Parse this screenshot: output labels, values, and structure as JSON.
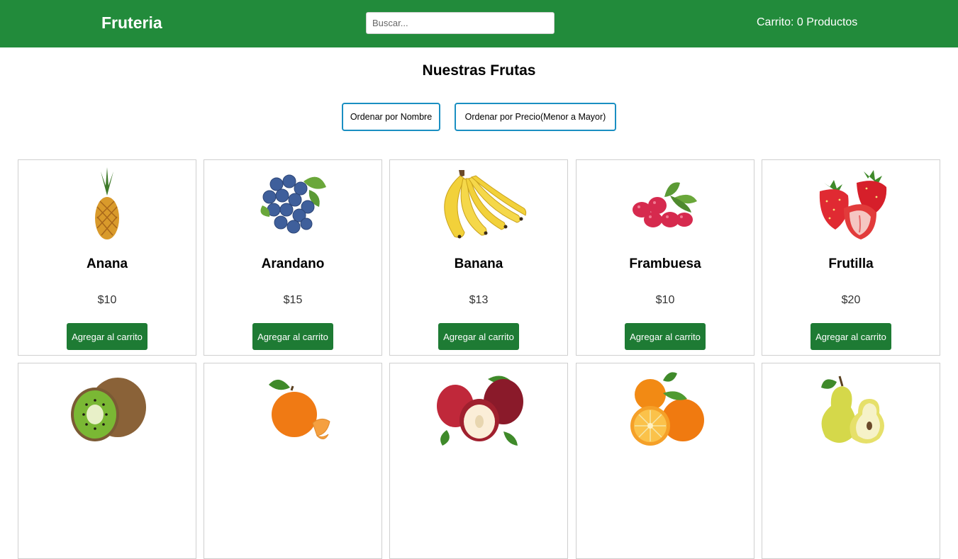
{
  "header": {
    "brand": "Fruteria",
    "search_placeholder": "Buscar...",
    "cart_label": "Carrito: 0 Productos"
  },
  "main": {
    "title": "Nuestras Frutas",
    "sort_by_name": "Ordenar por Nombre",
    "sort_by_price": "Ordenar por Precio(Menor a Mayor)"
  },
  "products": [
    {
      "name": "Anana",
      "price": "$10",
      "button": "Agregar al carrito",
      "icon": "pineapple-icon"
    },
    {
      "name": "Arandano",
      "price": "$15",
      "button": "Agregar al carrito",
      "icon": "blueberries-icon"
    },
    {
      "name": "Banana",
      "price": "$13",
      "button": "Agregar al carrito",
      "icon": "bananas-icon"
    },
    {
      "name": "Frambuesa",
      "price": "$10",
      "button": "Agregar al carrito",
      "icon": "raspberries-icon"
    },
    {
      "name": "Frutilla",
      "price": "$20",
      "button": "Agregar al carrito",
      "icon": "strawberries-icon"
    },
    {
      "icon": "kiwi-icon"
    },
    {
      "icon": "mandarin-icon"
    },
    {
      "icon": "apples-icon"
    },
    {
      "icon": "oranges-icon"
    },
    {
      "icon": "pears-icon"
    }
  ],
  "colors": {
    "header_bg": "#228b3b",
    "button_bg": "#1e7b34",
    "sort_border": "#1a8fc2"
  }
}
